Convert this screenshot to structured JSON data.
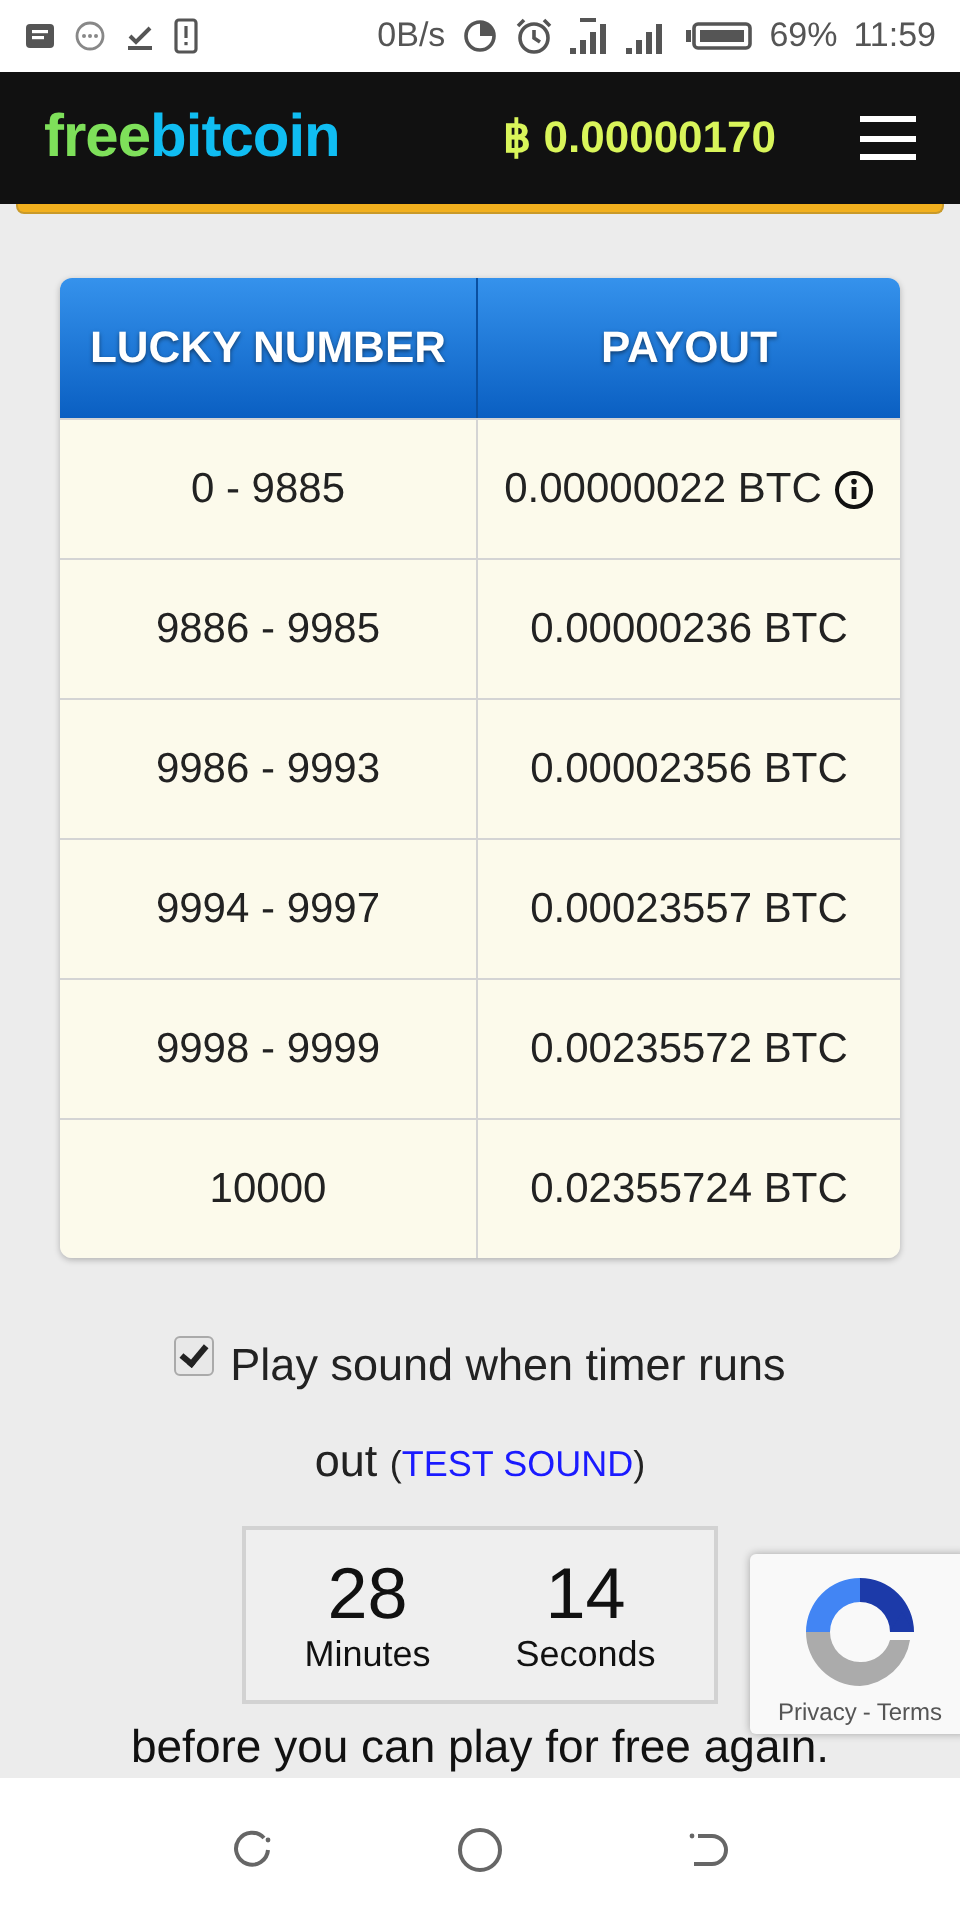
{
  "status_bar": {
    "network_speed": "0B/s",
    "battery": "69%",
    "time": "11:59"
  },
  "header": {
    "logo": [
      {
        "text": "free",
        "color": "#7ee05a"
      },
      {
        "text": "bitcoin",
        "color": "#10bdf2"
      }
    ],
    "currency_symbol": "฿",
    "balance": "0.00000170"
  },
  "payout_table": {
    "columns": [
      "LUCKY NUMBER",
      "PAYOUT"
    ],
    "rows": [
      {
        "lucky_number": "0 - 9885",
        "payout": "0.00000022 BTC",
        "info": true
      },
      {
        "lucky_number": "9886 - 9985",
        "payout": "0.00000236 BTC",
        "info": false
      },
      {
        "lucky_number": "9986 - 9993",
        "payout": "0.00002356 BTC",
        "info": false
      },
      {
        "lucky_number": "9994 - 9997",
        "payout": "0.00023557 BTC",
        "info": false
      },
      {
        "lucky_number": "9998 - 9999",
        "payout": "0.00235572 BTC",
        "info": false
      },
      {
        "lucky_number": "10000",
        "payout": "0.02355724 BTC",
        "info": false
      }
    ]
  },
  "sound_option": {
    "checked": true,
    "label": "Play sound when timer runs out",
    "link_open": "(",
    "link": "TEST SOUND",
    "link_close": ")"
  },
  "timer": {
    "units": [
      {
        "value": "28",
        "label": "Minutes"
      },
      {
        "value": "14",
        "label": "Seconds"
      }
    ]
  },
  "recaptcha": {
    "privacy": "Privacy",
    "separator": "-",
    "terms": "Terms"
  },
  "footer_text": "before you can play for free again."
}
